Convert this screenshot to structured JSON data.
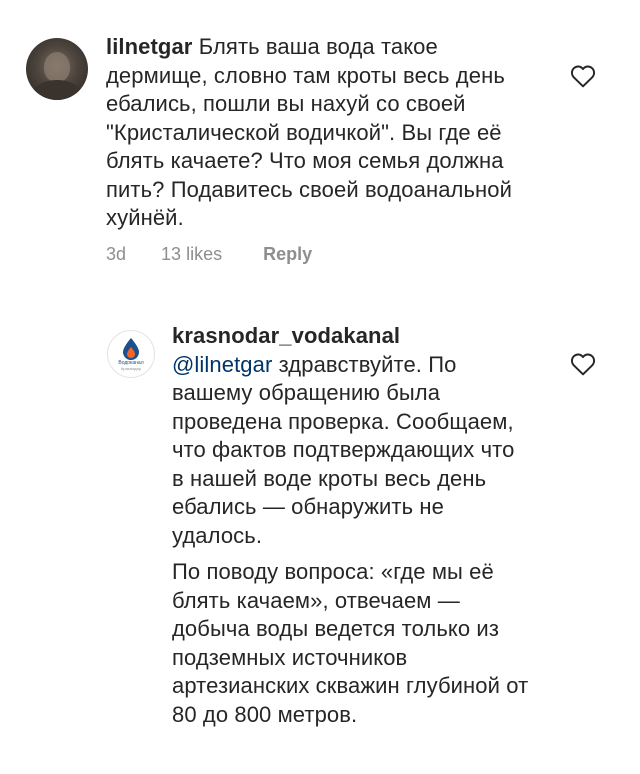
{
  "comments": [
    {
      "username": "lilnetgar",
      "text": "Блять ваша вода такое дермище, словно там кроты весь день ебались, пошли вы нахуй со своей \"Кристалической водичкой\". Вы где её блять качаете? Что моя семья должна пить? Подавитесь своей водоанальной хуйнёй.",
      "time": "3d",
      "likes": "13 likes",
      "reply": "Reply",
      "like_icon": "heart-outline-icon"
    },
    {
      "username": "krasnodar_vodakanal",
      "mention": "@lilnetgar",
      "text_para1": " здравствуйте. По вашему обращению была проведена проверка. Сообщаем, что фактов подтверждающих что в нашей воде кроты весь день ебались — обнаружить не удалось.",
      "text_para2": "По поводу вопроса: «где мы её блять качаем», отвечаем — добыча воды ведется только из подземных источников артезианских скважин глубиной от 80 до 800 метров.",
      "avatar_logo_text": "Водоканал",
      "avatar_logo_subtext": "Краснодар",
      "like_icon": "heart-outline-icon"
    }
  ],
  "colors": {
    "text": "#262626",
    "meta": "#8e8e8e",
    "mention": "#003569",
    "logo_blue": "#1f4e8c",
    "logo_orange": "#f26522"
  }
}
